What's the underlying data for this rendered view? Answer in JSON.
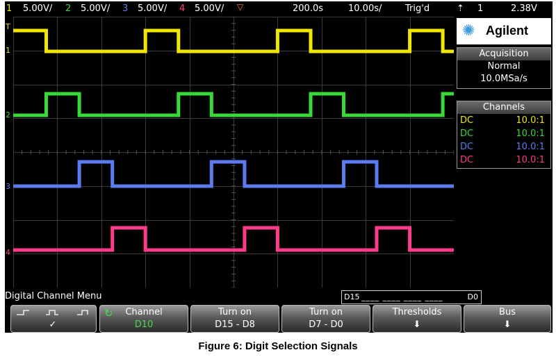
{
  "status_bar": {
    "channels": [
      {
        "num": "1",
        "scale": "5.00V/",
        "color": "#f2e600"
      },
      {
        "num": "2",
        "scale": "5.00V/",
        "color": "#37d837"
      },
      {
        "num": "3",
        "scale": "5.00V/",
        "color": "#5a7cf0"
      },
      {
        "num": "4",
        "scale": "5.00V/",
        "color": "#ff3a8a"
      }
    ],
    "timebase": "200.0s",
    "delay": "10.00s/",
    "trigger_status": "Trig'd",
    "trigger_source": "1",
    "trigger_level": "2.38V"
  },
  "brand": {
    "name": "Agilent"
  },
  "acquisition": {
    "title": "Acquisition",
    "mode": "Normal",
    "rate": "10.0MSa/s"
  },
  "channels_panel": {
    "title": "Channels",
    "rows": [
      {
        "coupling": "DC",
        "probe": "10.0:1",
        "color": "#f2e600"
      },
      {
        "coupling": "DC",
        "probe": "10.0:1",
        "color": "#37d837"
      },
      {
        "coupling": "DC",
        "probe": "10.0:1",
        "color": "#5a7cf0"
      },
      {
        "coupling": "DC",
        "probe": "10.0:1",
        "color": "#ff3a8a"
      }
    ]
  },
  "waveforms": [
    {
      "channel": "1",
      "color": "#f2e600",
      "start_high": true,
      "edges": [
        0.075,
        0.3,
        0.375,
        0.6,
        0.675,
        0.9,
        0.975
      ]
    },
    {
      "channel": "2",
      "color": "#37d837",
      "start_high": false,
      "edges": [
        0.075,
        0.15,
        0.375,
        0.45,
        0.675,
        0.75,
        0.975
      ]
    },
    {
      "channel": "3",
      "color": "#5a7cf0",
      "start_high": false,
      "edges": [
        0.15,
        0.225,
        0.45,
        0.525,
        0.75,
        0.825
      ]
    },
    {
      "channel": "4",
      "color": "#ff3a8a",
      "start_high": false,
      "edges": [
        0.225,
        0.3,
        0.525,
        0.6,
        0.825,
        0.9
      ]
    }
  ],
  "menu": {
    "title": "Digital Channel Menu",
    "digital_bits_left": "D15",
    "digital_bits_right": "D0",
    "softkeys": [
      {
        "line1": "",
        "line2": "✓"
      },
      {
        "line1": "Channel",
        "line2": "D10"
      },
      {
        "line1": "Turn on",
        "line2": "D15 - D8"
      },
      {
        "line1": "Turn on",
        "line2": "D7 - D0"
      },
      {
        "line1": "Thresholds",
        "line2": "⬇"
      },
      {
        "line1": "Bus",
        "line2": "⬇"
      }
    ]
  },
  "caption": "Figure 6: Digit Selection Signals"
}
